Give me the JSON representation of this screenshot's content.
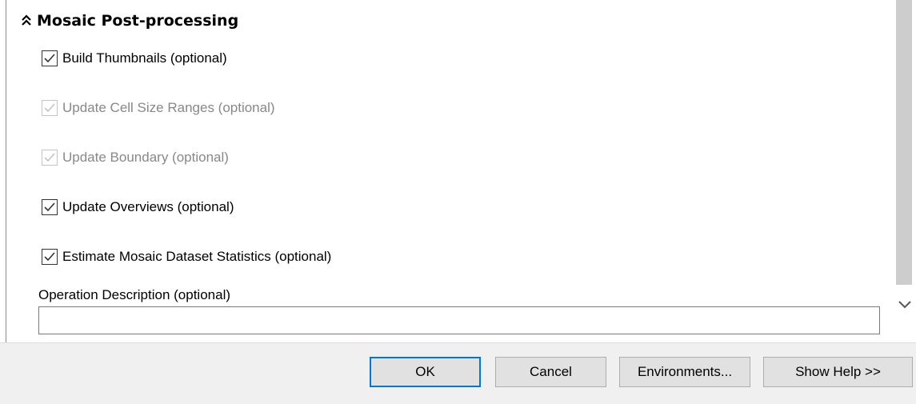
{
  "section": {
    "title": "Mosaic Post-processing",
    "collapse_icon": "double-chevron-up-icon"
  },
  "options": [
    {
      "label": "Build Thumbnails (optional)",
      "checked": true,
      "enabled": true
    },
    {
      "label": "Update Cell Size Ranges (optional)",
      "checked": true,
      "enabled": false
    },
    {
      "label": "Update Boundary (optional)",
      "checked": true,
      "enabled": false
    },
    {
      "label": "Update Overviews (optional)",
      "checked": true,
      "enabled": true
    },
    {
      "label": "Estimate Mosaic Dataset Statistics (optional)",
      "checked": true,
      "enabled": true
    }
  ],
  "operation_description": {
    "label": "Operation Description (optional)",
    "value": ""
  },
  "buttons": {
    "ok": "OK",
    "cancel": "Cancel",
    "environments": "Environments...",
    "show_help": "Show Help >>"
  },
  "scroll": {
    "down_icon": "chevron-down-icon"
  },
  "colors": {
    "default_button_border": "#0078d7",
    "disabled_text": "#888888",
    "panel_background": "#f0f0f0"
  }
}
